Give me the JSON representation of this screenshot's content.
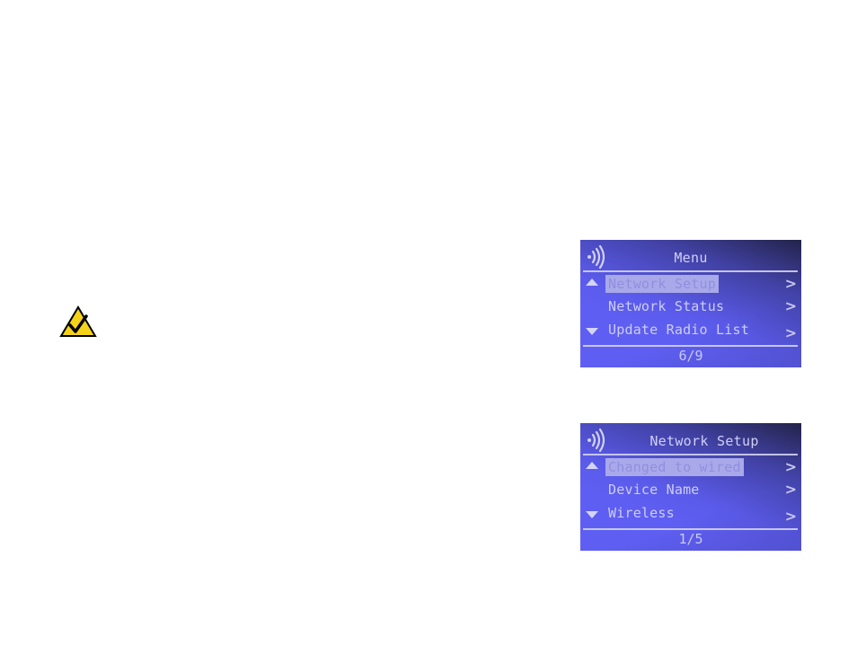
{
  "note": {
    "icon": "checkmark-warning-icon",
    "colors": {
      "fill": "#f5d21a",
      "border": "#000000"
    }
  },
  "screens": [
    {
      "icon": "wireless-signal-icon",
      "title": "Menu",
      "items": [
        {
          "label": "Network Setup",
          "selected": true,
          "indicator": "up-arrow"
        },
        {
          "label": "Network Status",
          "selected": false,
          "indicator": ""
        },
        {
          "label": "Update Radio List",
          "selected": false,
          "indicator": "down-arrow"
        }
      ],
      "chevron": ">",
      "pager": "6/9"
    },
    {
      "icon": "wireless-signal-icon",
      "title": "Network Setup",
      "items": [
        {
          "label": "Changed to wired",
          "selected": true,
          "indicator": "up-arrow"
        },
        {
          "label": "Device Name",
          "selected": false,
          "indicator": ""
        },
        {
          "label": "Wireless",
          "selected": false,
          "indicator": "down-arrow"
        }
      ],
      "chevron": ">",
      "pager": "1/5"
    }
  ],
  "colors": {
    "lcd_background": "#5e5ef2",
    "lcd_text": "#cdcdf4",
    "lcd_selected_bg": "#a9a9ea"
  }
}
